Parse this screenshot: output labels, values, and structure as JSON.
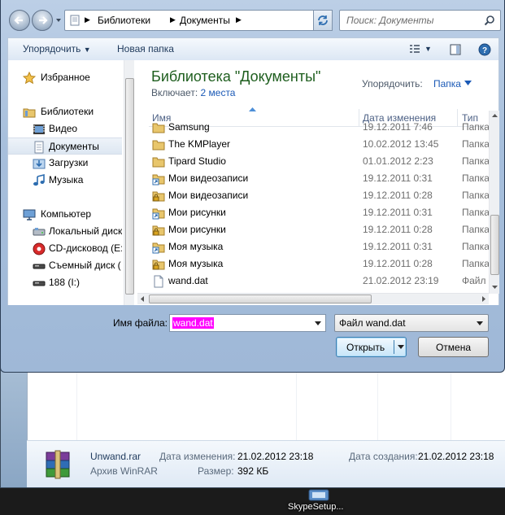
{
  "dialog": {
    "address": {
      "crumbs": [
        "Библиотеки",
        "Документы"
      ]
    },
    "search": {
      "placeholder": "Поиск: Документы"
    },
    "toolbar": {
      "organize": "Упорядочить",
      "new_folder": "Новая папка"
    },
    "nav": {
      "favorites": "Избранное",
      "libraries": "Библиотеки",
      "lib_items": [
        "Видео",
        "Документы",
        "Загрузки",
        "Музыка"
      ],
      "computer": "Компьютер",
      "drives": [
        "Локальный диск",
        "CD-дисковод (E:",
        "Съемный диск (",
        "188 (I:)"
      ]
    },
    "content": {
      "title": "Библиотека \"Документы\"",
      "includes_label": "Включает:",
      "includes_link": "2 места",
      "arrange_label": "Упорядочить:",
      "arrange_value": "Папка",
      "columns": {
        "name": "Имя",
        "date": "Дата изменения",
        "type": "Тип"
      },
      "rows": [
        {
          "name": "Samsung",
          "date": "19.12.2011 7:46",
          "type": "Папка",
          "icon": "folder"
        },
        {
          "name": "The KMPlayer",
          "date": "10.02.2012 13:45",
          "type": "Папка",
          "icon": "folder"
        },
        {
          "name": "Tipard Studio",
          "date": "01.01.2012 2:23",
          "type": "Папка",
          "icon": "folder"
        },
        {
          "name": "Мои видеозаписи",
          "date": "19.12.2011 0:31",
          "type": "Папка",
          "icon": "shortcut"
        },
        {
          "name": "Мои видеозаписи",
          "date": "19.12.2011 0:28",
          "type": "Папка",
          "icon": "locked"
        },
        {
          "name": "Мои рисунки",
          "date": "19.12.2011 0:31",
          "type": "Папка",
          "icon": "shortcut"
        },
        {
          "name": "Мои рисунки",
          "date": "19.12.2011 0:28",
          "type": "Папка",
          "icon": "locked"
        },
        {
          "name": "Моя музыка",
          "date": "19.12.2011 0:31",
          "type": "Папка",
          "icon": "shortcut"
        },
        {
          "name": "Моя музыка",
          "date": "19.12.2011 0:28",
          "type": "Папка",
          "icon": "locked"
        },
        {
          "name": "wand.dat",
          "date": "21.02.2012 23:19",
          "type": "Файл \"",
          "icon": "file"
        }
      ]
    },
    "bottom": {
      "filename_label": "Имя файла:",
      "filename_value": "wand.dat",
      "filter_value": "Файл wand.dat",
      "open_label": "Открыть",
      "cancel_label": "Отмена"
    }
  },
  "background": {
    "file_name": "Unwand.rar",
    "file_type": "Архив WinRAR",
    "modified_label": "Дата изменения:",
    "modified_value": "21.02.2012 23:18",
    "size_label": "Размер:",
    "size_value": "392 КБ",
    "created_label": "Дата создания:",
    "created_value": "21.02.2012 23:18"
  },
  "desktop": {
    "icon_label": "SkypeSetup..."
  }
}
